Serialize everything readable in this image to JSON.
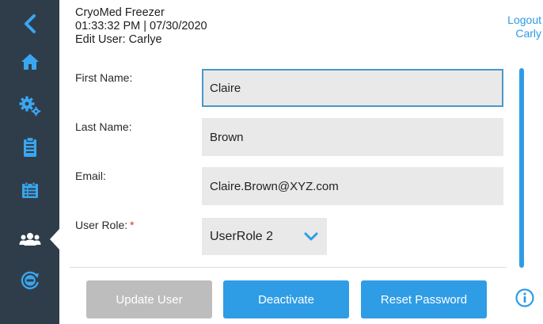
{
  "header": {
    "app_name": "CryoMed Freezer",
    "datetime": "01:33:32 PM | 07/30/2020",
    "page_title": "Edit User: Carlye"
  },
  "user_menu": {
    "logout_label": "Logout",
    "username": "Carly"
  },
  "sidebar": {
    "items": [
      {
        "icon": "back-chevron-icon"
      },
      {
        "icon": "home-icon"
      },
      {
        "icon": "gears-icon"
      },
      {
        "icon": "clipboard-icon"
      },
      {
        "icon": "records-icon"
      },
      {
        "icon": "users-icon",
        "active": true
      },
      {
        "icon": "calibration-icon"
      }
    ],
    "bg_color": "#2f3d4b",
    "icon_color": "#3aa6ee"
  },
  "form": {
    "first_name": {
      "label": "First Name:",
      "value": "Claire"
    },
    "last_name": {
      "label": "Last Name:",
      "value": "Brown"
    },
    "email": {
      "label": "Email:",
      "value": "Claire.Brown@XYZ.com"
    },
    "user_role": {
      "label": "User Role:",
      "required_mark": "*",
      "value": "UserRole 2"
    }
  },
  "actions": {
    "update_label": "Update User",
    "deactivate_label": "Deactivate",
    "reset_password_label": "Reset Password"
  },
  "colors": {
    "accent": "#2f9ce6",
    "disabled": "#bdbdbd",
    "input_bg": "#e9e9e9",
    "required": "#e0302a"
  }
}
